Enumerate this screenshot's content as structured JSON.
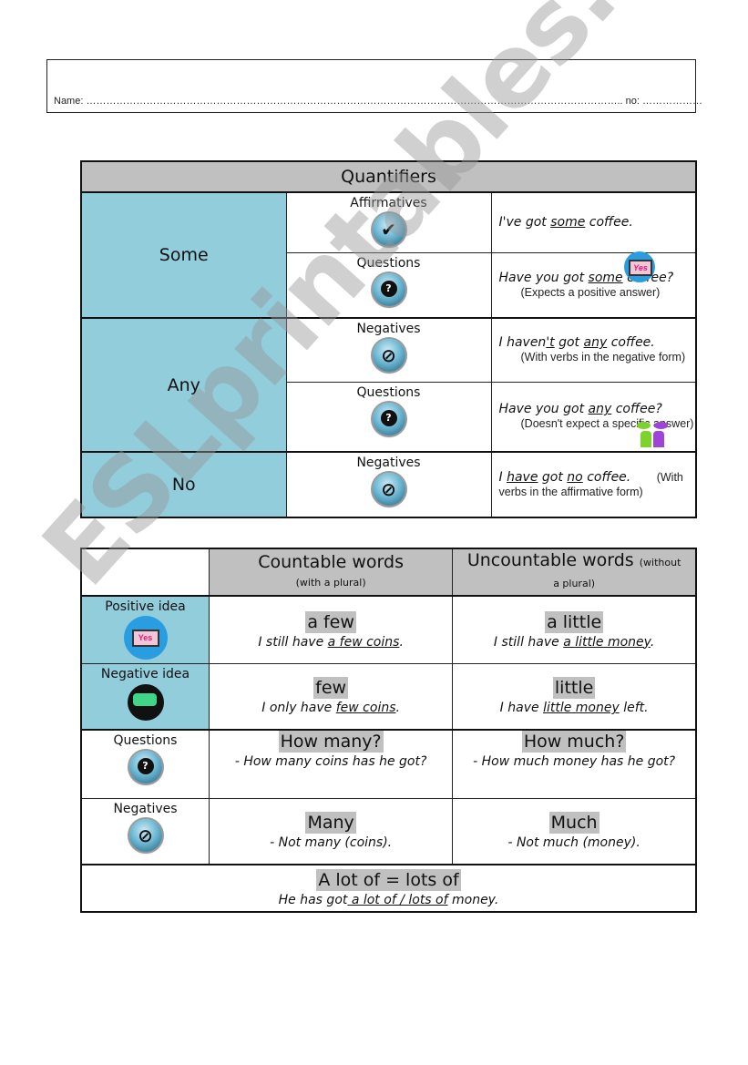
{
  "header": {
    "name_label": "Name:",
    "name_dots": "……………………………………………………………………………………………………………………………………………..",
    "no_label": "no:",
    "no_dots": "………………"
  },
  "table1": {
    "title": "Quantifiers",
    "groups": [
      {
        "quantifier": "Some",
        "rows": [
          {
            "category": "Affirmatives",
            "icon": "check-icon",
            "pre": "I've got ",
            "u": "some",
            "post": " coffee.",
            "note": ""
          },
          {
            "category": "Questions",
            "icon": "question-icon",
            "pre": "Have you got ",
            "u": "some",
            "post": " coffee?",
            "note": "(Expects a positive answer)",
            "badge": "Yes"
          }
        ]
      },
      {
        "quantifier": "Any",
        "rows": [
          {
            "category": "Negatives",
            "icon": "prohibited-icon",
            "pre": "I haven",
            "u0": "'t",
            "mid": " got ",
            "u": "any",
            "post": " coffee.",
            "note": "(With verbs in the negative form)"
          },
          {
            "category": "Questions",
            "icon": "question-icon",
            "pre": "Have you got ",
            "u": "any",
            "post": " coffee?",
            "note": "(Doesn't expect a specific answer)"
          }
        ]
      },
      {
        "quantifier": "No",
        "rows": [
          {
            "category": "Negatives",
            "icon": "prohibited-icon",
            "pre": "I ",
            "u0": "have",
            "mid": " got ",
            "u": "no",
            "post": " coffee.",
            "note": "(With verbs in the affirmative form)"
          }
        ]
      }
    ]
  },
  "table2": {
    "col1_title": "Countable words",
    "col1_sub": "(with a plural)",
    "col2_title": "Uncountable words",
    "col2_sub_inline": "(without",
    "col2_sub": "a plural)",
    "rows": [
      {
        "label": "Positive idea",
        "c1_word": "a few",
        "c1_pre": "I still have ",
        "c1_u": "a few coins",
        "c1_post": ".",
        "c2_word": "a little",
        "c2_pre": "I still have ",
        "c2_u": "a little money",
        "c2_post": "."
      },
      {
        "label": "Negative idea",
        "c1_word": "few",
        "c1_pre": "I only have ",
        "c1_u": "few coins",
        "c1_post": ".",
        "c2_word": "little",
        "c2_pre": "I have ",
        "c2_u": "little money",
        "c2_post": " left."
      },
      {
        "label": "Questions",
        "c1_word": "How many?",
        "c1_sent": "- How many coins has he got?",
        "c2_word": "How much?",
        "c2_sent": "- How much money has he got?"
      },
      {
        "label": "Negatives",
        "c1_word": "Many",
        "c1_sent": "- Not many (coins).",
        "c2_word": "Much",
        "c2_sent": "- Not much (money)."
      }
    ],
    "footer_word": "A lot of = lots of",
    "footer_pre": "He has got",
    "footer_u": " a lot of / lots of",
    "footer_post": " money."
  },
  "watermark": "ESLprintables.com",
  "colors": {
    "header_gray": "#c0c0c0",
    "side_blue": "#92cddc"
  }
}
